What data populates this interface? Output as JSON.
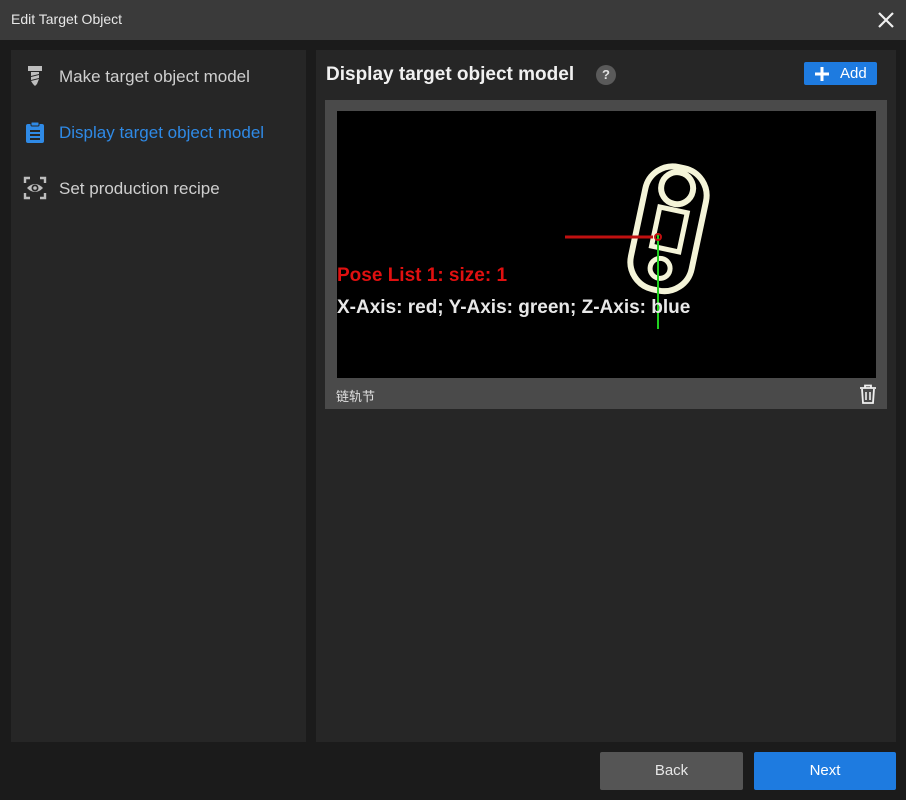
{
  "window": {
    "title": "Edit Target Object"
  },
  "sidebar": {
    "items": [
      {
        "label": "Make target object model",
        "icon": "screw-icon"
      },
      {
        "label": "Display target object model",
        "icon": "clipboard-icon",
        "active": true
      },
      {
        "label": "Set production recipe",
        "icon": "eye-scan-icon"
      }
    ]
  },
  "main": {
    "heading": "Display target object model",
    "help": "?",
    "add_label": "Add"
  },
  "model_card": {
    "pose_title": "Pose List 1: size: 1",
    "axes_legend": "X-Axis: red; Y-Axis: green; Z-Axis: blue",
    "caption": "链轨节"
  },
  "footer": {
    "back_label": "Back",
    "next_label": "Next"
  },
  "colors": {
    "accent": "#1e7be0",
    "active_text": "#2f8ae6",
    "pose_title": "#e01010"
  }
}
